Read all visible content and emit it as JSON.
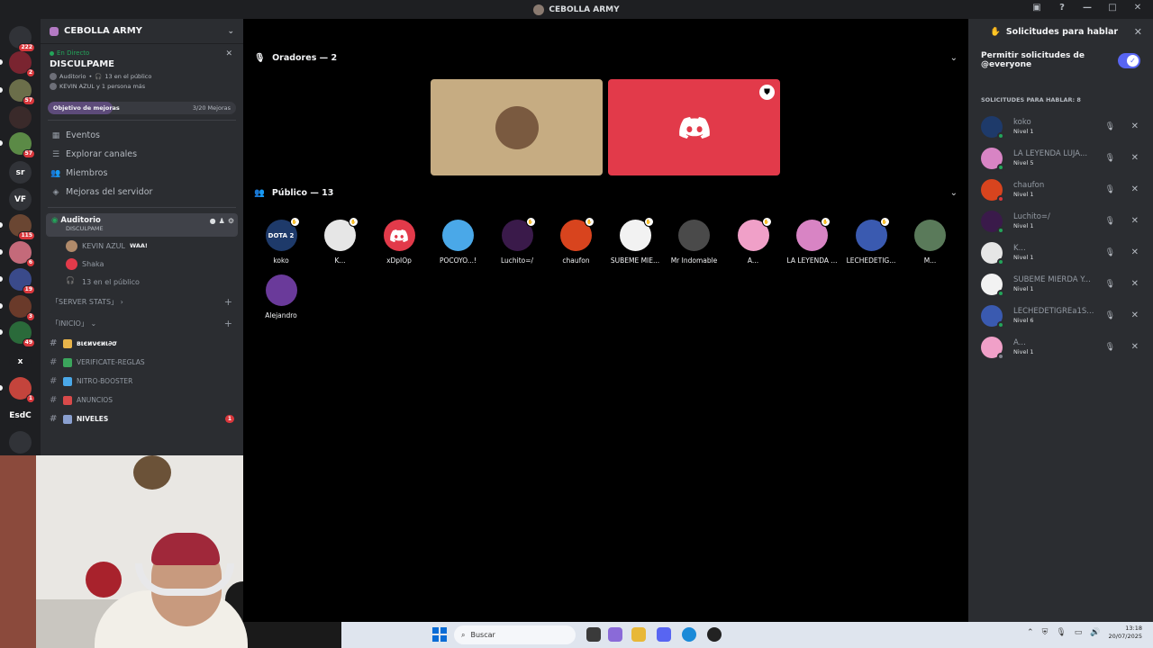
{
  "window": {
    "title": "CEBOLLA ARMY"
  },
  "guilds": [
    {
      "label": "",
      "badge": "222",
      "color": "#313338"
    },
    {
      "label": "",
      "badge": "2",
      "color": "#7a2430"
    },
    {
      "label": "",
      "badge": "57",
      "color": "#6b6e4a"
    },
    {
      "label": "",
      "badge": "",
      "color": "#3a2a2a"
    },
    {
      "label": "",
      "badge": "57",
      "color": "#5b8a46"
    },
    {
      "label": "sr",
      "badge": "",
      "color": "#313338"
    },
    {
      "label": "VF",
      "badge": "",
      "color": "#313338"
    },
    {
      "label": "",
      "badge": "115",
      "color": "#6a4632"
    },
    {
      "label": "",
      "badge": "6",
      "color": "#c46a7a"
    },
    {
      "label": "",
      "badge": "19",
      "color": "#3a4a8a"
    },
    {
      "label": "",
      "badge": "3",
      "color": "#6a3a2a"
    },
    {
      "label": "",
      "badge": "49",
      "color": "#2a6a3a"
    },
    {
      "label": "x",
      "badge": "",
      "color": "#1e1f22"
    },
    {
      "label": "",
      "badge": "1",
      "color": "#c4443c"
    },
    {
      "label": "EsdC",
      "badge": "",
      "color": "#1e1f22"
    },
    {
      "label": "",
      "badge": "",
      "color": "#313338"
    }
  ],
  "server": {
    "name": "CEBOLLA ARMY",
    "live": {
      "tag": "En Directo",
      "title": "DISCULPAME",
      "channel": "Auditorio",
      "audience": "13 en el público",
      "speakers": "KEVIN AZUL y 1 persona más"
    },
    "goal": {
      "label": "Objetivo de mejoras",
      "count": "3/20 Mejoras",
      "progress": 0.15
    },
    "nav": [
      {
        "label": "Eventos",
        "icon": "calendar-icon"
      },
      {
        "label": "Explorar canales",
        "icon": "browse-icon"
      },
      {
        "label": "Miembros",
        "icon": "members-icon"
      },
      {
        "label": "Mejoras del servidor",
        "icon": "boost-icon"
      }
    ],
    "active_channel": {
      "name": "Auditorio",
      "sub": "DISCULPAME"
    },
    "voice_users": [
      {
        "name": "KEVIN AZUL",
        "tag": "WAA!"
      },
      {
        "name": "Shaka",
        "tag": ""
      },
      {
        "name": "13 en el público",
        "tag": ""
      }
    ],
    "categories": [
      "「SERVER STATS」",
      "「INICIO」"
    ],
    "text_channels": [
      {
        "name": "вιєиνєиι∂σ",
        "emoji": "#e8b44a",
        "unread": true,
        "badge": ""
      },
      {
        "name": "VERIFICATE-REGLAS",
        "emoji": "#3ba55c",
        "unread": false,
        "badge": ""
      },
      {
        "name": "NITRO-BOOSTER",
        "emoji": "#4aa8e8",
        "unread": false,
        "badge": ""
      },
      {
        "name": "ANUNCIOS",
        "emoji": "#d84a4a",
        "unread": false,
        "badge": ""
      },
      {
        "name": "NIVELES",
        "emoji": "#8aa0d0",
        "unread": true,
        "badge": "1"
      }
    ]
  },
  "stage": {
    "speakers_header": "Oradores — 2",
    "audience_header": "Público — 13",
    "speakers": [
      {
        "tile_color": "#c6ac82",
        "avatar_color": "#7a5a40",
        "mod": false,
        "discord": false
      },
      {
        "tile_color": "#e23a4a",
        "avatar_color": "",
        "mod": true,
        "discord": true
      }
    ],
    "audience": [
      {
        "name": "koko",
        "color": "#1e3a6a",
        "badge": true,
        "label": "DOTA 2"
      },
      {
        "name": "K...",
        "color": "#e6e6e6",
        "badge": true,
        "label": ""
      },
      {
        "name": "xDpIOp",
        "color": "#e23a4a",
        "badge": false,
        "label": ""
      },
      {
        "name": "POCOYO...!",
        "color": "#4aa8e8",
        "badge": false,
        "label": ""
      },
      {
        "name": "Luchito=/",
        "color": "#3a1a4a",
        "badge": true,
        "label": ""
      },
      {
        "name": "chaufon",
        "color": "#d8441e",
        "badge": true,
        "label": ""
      },
      {
        "name": "SUBEME MIE...",
        "color": "#f2f2f2",
        "badge": true,
        "label": ""
      },
      {
        "name": "Mr Indomable",
        "color": "#4a4a4a",
        "badge": false,
        "label": ""
      },
      {
        "name": "A...",
        "color": "#f0a0c8",
        "badge": true,
        "label": ""
      },
      {
        "name": "LA LEYENDA ...",
        "color": "#d884c4",
        "badge": true,
        "label": ""
      },
      {
        "name": "LECHEDETIG...",
        "color": "#3a5ab0",
        "badge": true,
        "label": ""
      },
      {
        "name": "M...",
        "color": "#5a7a5a",
        "badge": false,
        "label": ""
      },
      {
        "name": "Alejandro",
        "color": "#6a3a9a",
        "badge": false,
        "label": ""
      }
    ]
  },
  "requests": {
    "title": "Solicitudes para hablar",
    "permission": "Permitir solicitudes de @everyone",
    "count_label": "SOLICITUDES PARA HABLAR: 8",
    "items": [
      {
        "name": "koko",
        "level": "Nivel 1",
        "color": "#1e3a6a",
        "status": "#23a55a"
      },
      {
        "name": "LA LEYENDA LUJA...",
        "level": "Nivel 5",
        "color": "#d884c4",
        "status": "#23a55a"
      },
      {
        "name": "chaufon",
        "level": "Nivel 1",
        "color": "#d8441e",
        "status": "#da373c"
      },
      {
        "name": "Luchito=/",
        "level": "Nivel 1",
        "color": "#3a1a4a",
        "status": "#23a55a"
      },
      {
        "name": "K...",
        "level": "Nivel 1",
        "color": "#e6e6e6",
        "status": "#23a55a"
      },
      {
        "name": "SUBEME MIERDA Y...",
        "level": "Nivel 1",
        "color": "#f2f2f2",
        "status": "#23a55a"
      },
      {
        "name": "LECHEDETIGREa1S...",
        "level": "Nivel 6",
        "color": "#3a5ab0",
        "status": "#23a55a"
      },
      {
        "name": "A...",
        "level": "Nivel 1",
        "color": "#f0a0c8",
        "status": "#80848e"
      }
    ]
  },
  "taskbar": {
    "search_placeholder": "Buscar",
    "time": "13:18",
    "date": "20/07/2025"
  }
}
